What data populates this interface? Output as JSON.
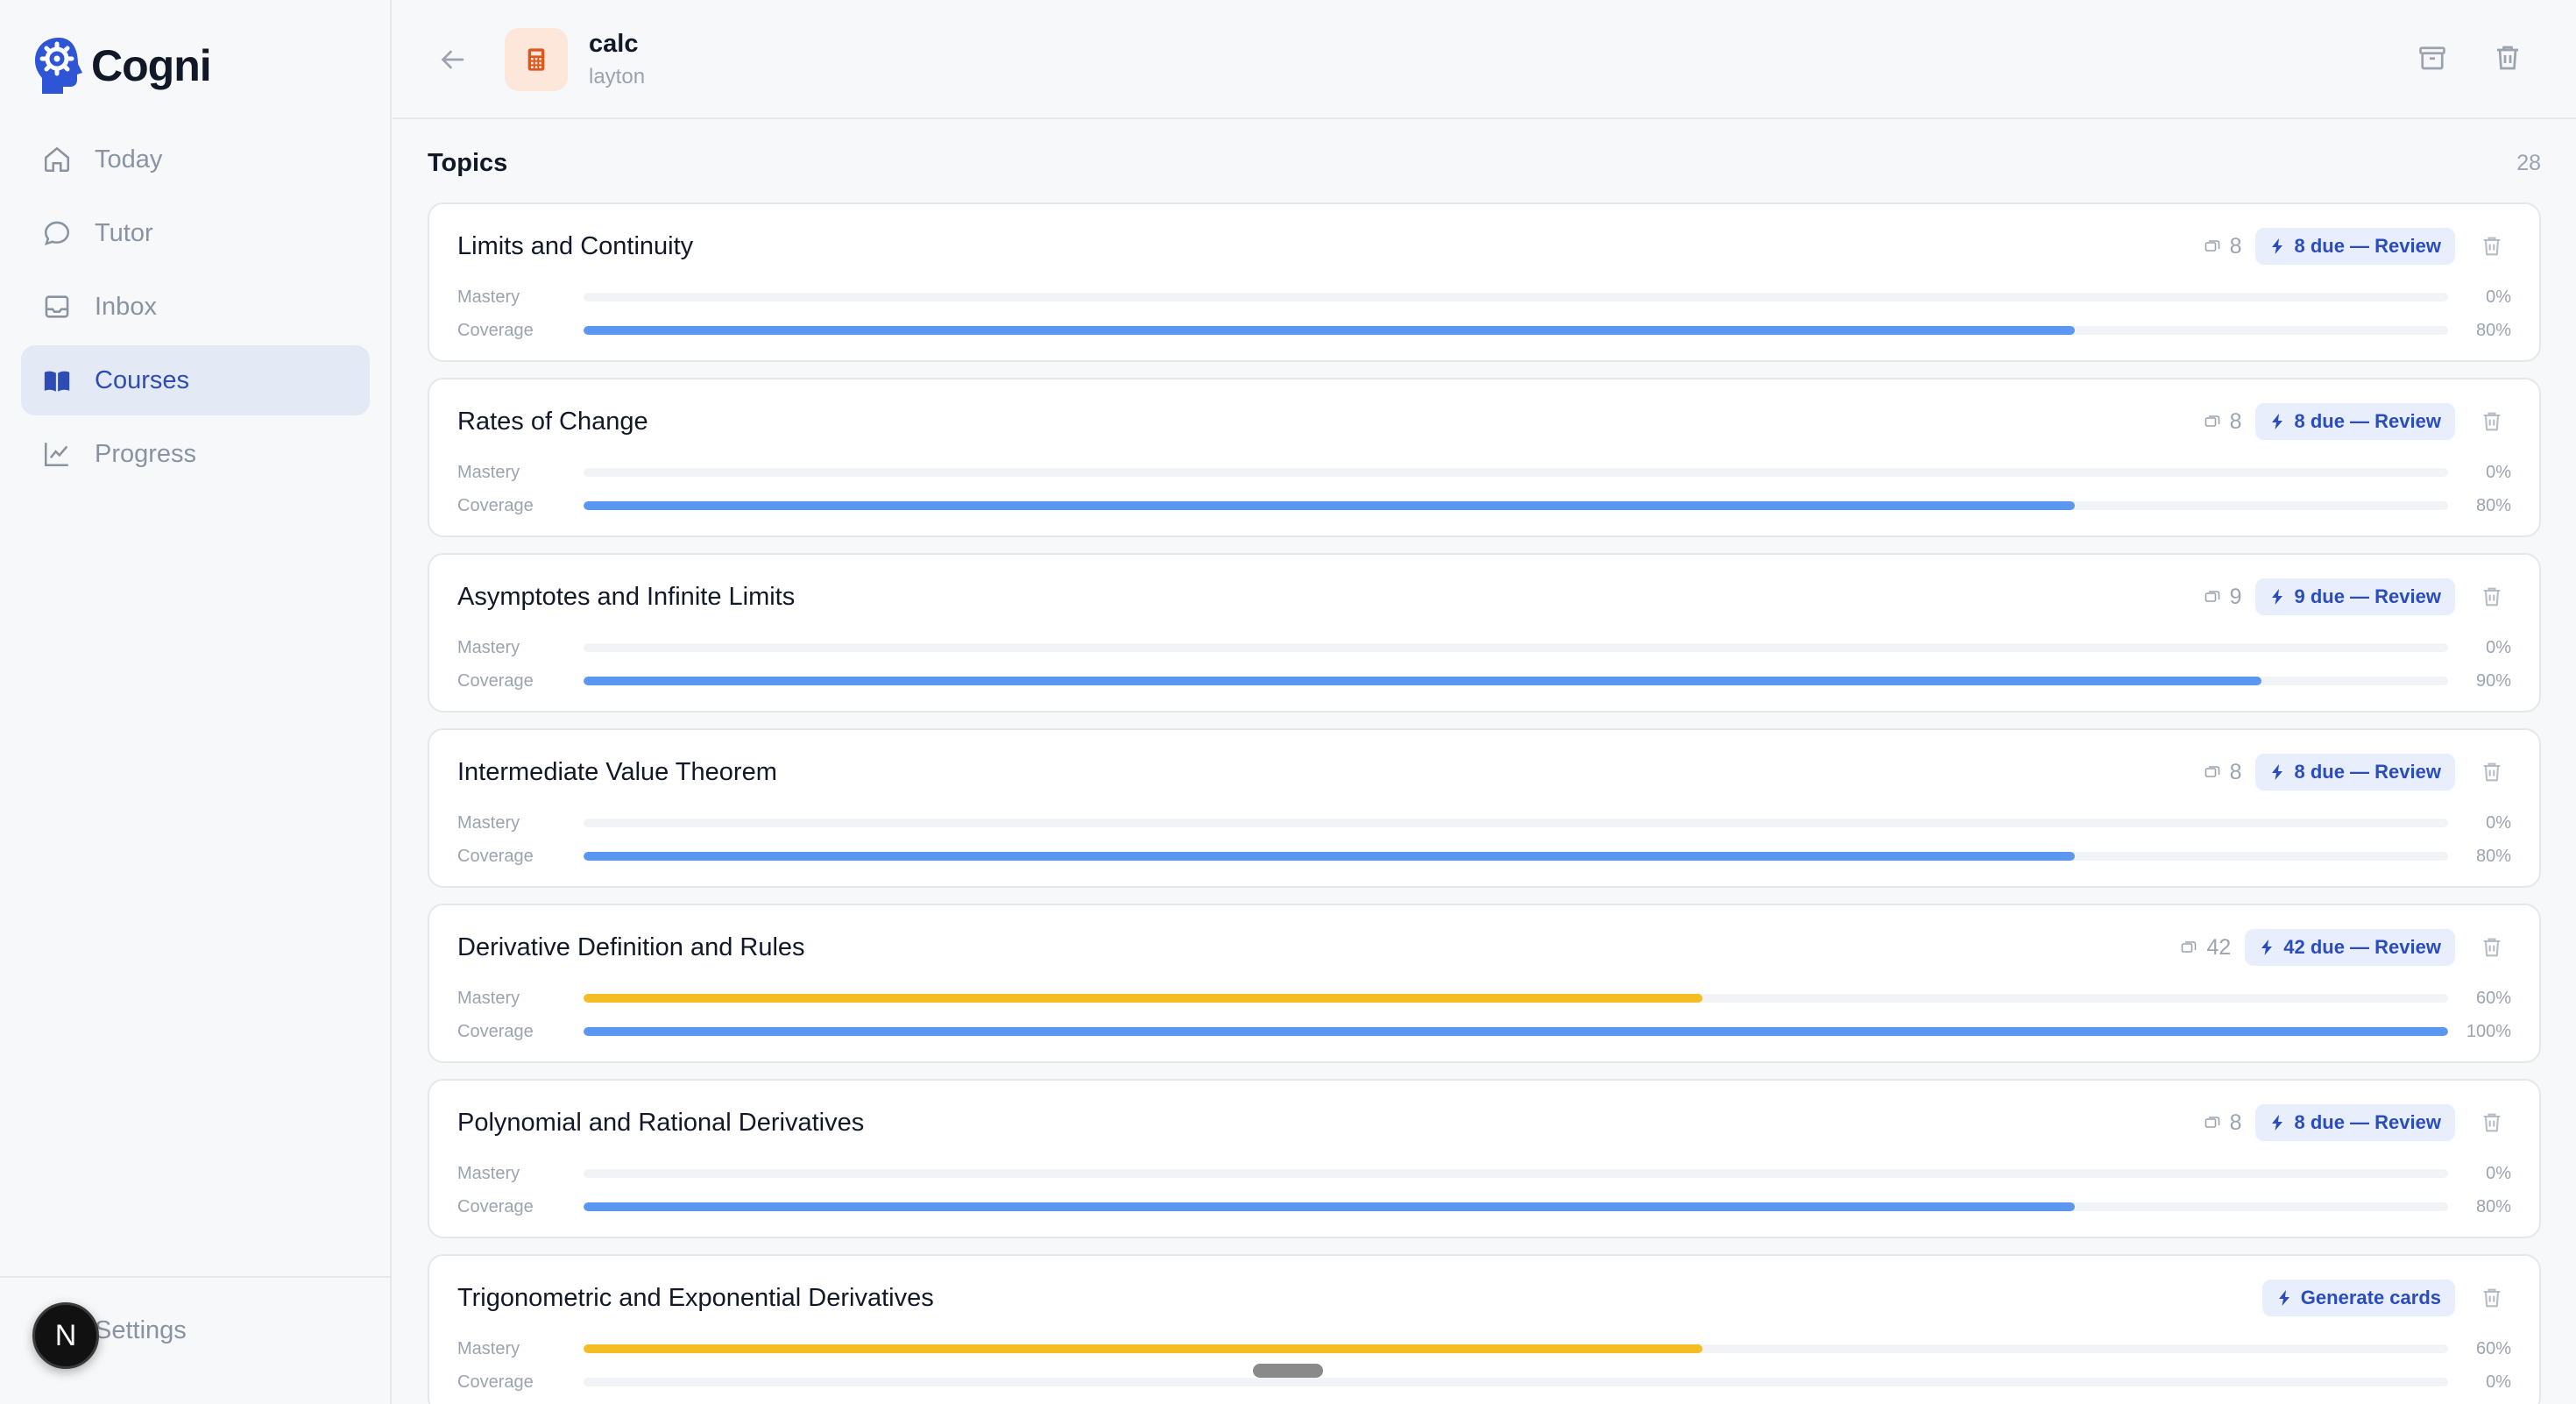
{
  "brand": {
    "name": "Cogni"
  },
  "sidebar": {
    "items": [
      {
        "label": "Today",
        "icon": "home-icon",
        "active": false
      },
      {
        "label": "Tutor",
        "icon": "chat-bubble-icon",
        "active": false
      },
      {
        "label": "Inbox",
        "icon": "inbox-icon",
        "active": false
      },
      {
        "label": "Courses",
        "icon": "book-icon",
        "active": true
      },
      {
        "label": "Progress",
        "icon": "chart-line-icon",
        "active": false
      }
    ],
    "settings_label": "Settings",
    "avatar_letter": "N"
  },
  "header": {
    "course_title": "calc",
    "course_subtitle": "layton",
    "course_icon": "calculator-icon",
    "accent_color": "#e0571d"
  },
  "topics": {
    "title": "Topics",
    "count": "28",
    "labels": {
      "mastery": "Mastery",
      "coverage": "Coverage"
    },
    "items": [
      {
        "title": "Limits and Continuity",
        "cards": "8",
        "action": "8 due — Review",
        "mastery": 0,
        "mastery_label": "0%",
        "coverage": 80,
        "coverage_label": "80%"
      },
      {
        "title": "Rates of Change",
        "cards": "8",
        "action": "8 due — Review",
        "mastery": 0,
        "mastery_label": "0%",
        "coverage": 80,
        "coverage_label": "80%"
      },
      {
        "title": "Asymptotes and Infinite Limits",
        "cards": "9",
        "action": "9 due — Review",
        "mastery": 0,
        "mastery_label": "0%",
        "coverage": 90,
        "coverage_label": "90%"
      },
      {
        "title": "Intermediate Value Theorem",
        "cards": "8",
        "action": "8 due — Review",
        "mastery": 0,
        "mastery_label": "0%",
        "coverage": 80,
        "coverage_label": "80%"
      },
      {
        "title": "Derivative Definition and Rules",
        "cards": "42",
        "action": "42 due — Review",
        "mastery": 60,
        "mastery_label": "60%",
        "coverage": 100,
        "coverage_label": "100%"
      },
      {
        "title": "Polynomial and Rational Derivatives",
        "cards": "8",
        "action": "8 due — Review",
        "mastery": 0,
        "mastery_label": "0%",
        "coverage": 80,
        "coverage_label": "80%"
      },
      {
        "title": "Trigonometric and Exponential Derivatives",
        "cards": null,
        "action": "Generate cards",
        "mastery": 60,
        "mastery_label": "60%",
        "coverage": 0,
        "coverage_label": "0%"
      }
    ]
  },
  "colors": {
    "mastery": "#f5bd24",
    "coverage": "#5b97f0",
    "accent": "#2b4cbc"
  }
}
